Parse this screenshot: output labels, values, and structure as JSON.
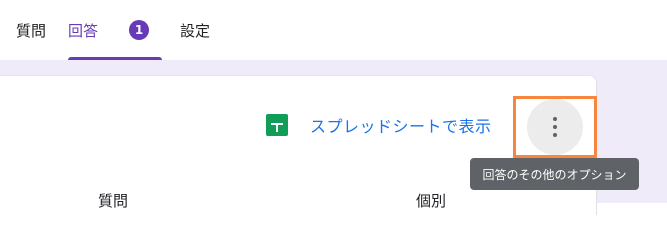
{
  "tabs": {
    "questions": "質問",
    "responses": "回答",
    "responses_count": "1",
    "settings": "設定"
  },
  "sheets_link": {
    "icon": "google-sheets-icon",
    "label": "スプレッドシートで表示"
  },
  "more_options": {
    "icon": "more-vert-icon",
    "tooltip": "回答のその他のオプション"
  },
  "summary_tabs": {
    "questions": "質問",
    "individual": "個別"
  },
  "colors": {
    "accent": "#673ab7",
    "background": "#f0ebf8",
    "link": "#1a73e8",
    "sheets_green": "#0f9d58",
    "highlight": "#f7873f",
    "tooltip_bg": "#5f6368"
  }
}
